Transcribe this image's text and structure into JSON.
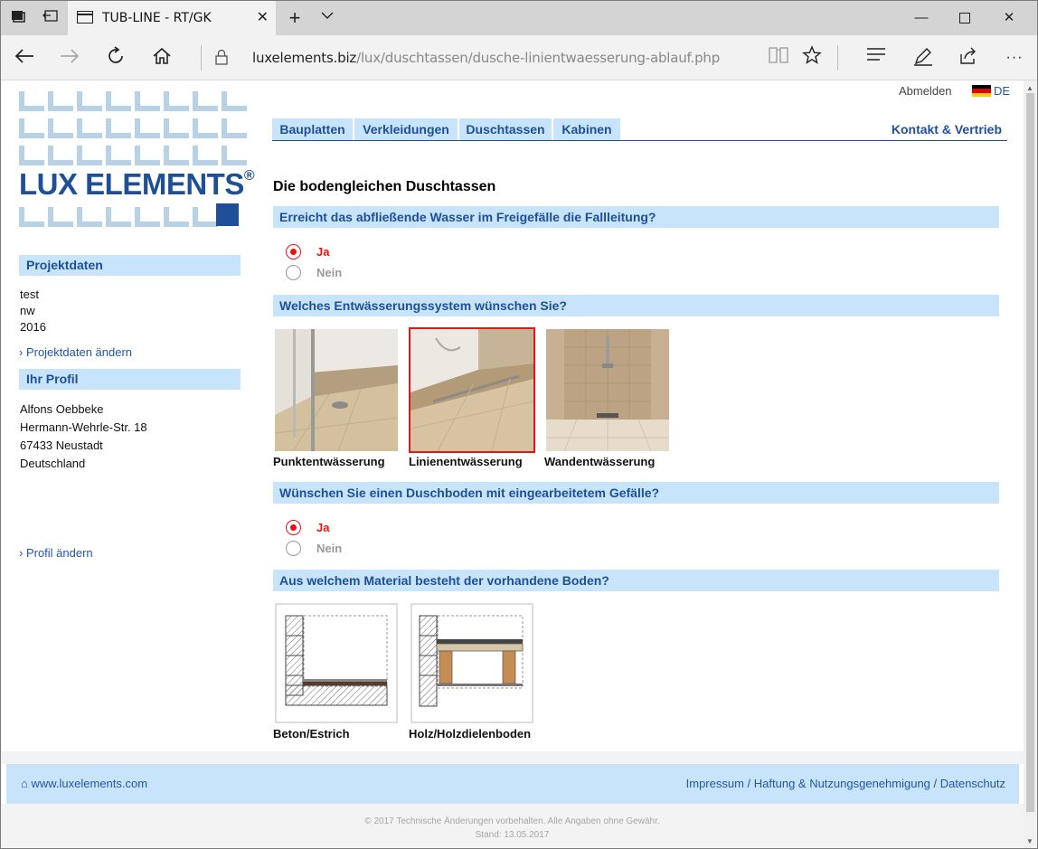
{
  "browser": {
    "tab_title": "TUB-LINE - RT/GK",
    "url_host": "luxelements.biz",
    "url_path": "/lux/duschtassen/dusche-linientwaesserung-ablauf.php"
  },
  "logo": {
    "text": "LUX ELEMENTS",
    "mark": "®"
  },
  "topbar": {
    "logout": "Abmelden",
    "language": "DE"
  },
  "nav": {
    "items": [
      "Bauplatten",
      "Verkleidungen",
      "Duschtassen",
      "Kabinen"
    ],
    "contact": "Kontakt & Vertrieb"
  },
  "sidebar": {
    "project_heading": "Projektdaten",
    "project_lines": [
      "test",
      "nw",
      "2016"
    ],
    "project_link": "› Projektdaten ändern",
    "profile_heading": "Ihr Profil",
    "profile_lines": [
      "Alfons Oebbeke",
      "Hermann-Wehrle-Str. 18",
      "67433 Neustadt",
      "Deutschland"
    ],
    "profile_link": "› Profil ändern"
  },
  "main": {
    "title": "Die bodengleichen Duschtassen",
    "questions": [
      {
        "text": "Erreicht das abfließende Wasser im Freigefälle die Fallleitung?",
        "options": [
          "Ja",
          "Nein"
        ],
        "selected": "Ja"
      },
      {
        "text": "Welches Entwässerungssystem wünschen Sie?",
        "options": [
          "Punktentwässerung",
          "Linienentwässerung",
          "Wandentwässerung"
        ],
        "selected": "Linienentwässerung"
      },
      {
        "text": "Wünschen Sie einen Duschboden mit eingearbeitetem Gefälle?",
        "options": [
          "Ja",
          "Nein"
        ],
        "selected": "Ja"
      },
      {
        "text": "Aus welchem Material besteht der vorhandene Boden?",
        "options": [
          "Beton/Estrich",
          "Holz/Holzdielenboden"
        ]
      }
    ]
  },
  "footer": {
    "site": "www.luxelements.com",
    "links": "Impressum / Haftung & Nutzungsgenehmigung / Datenschutz",
    "copyright": "© 2017 Technische Änderungen vorbehalten. Alle Angaben ohne Gewähr.",
    "stand": "Stand: 13.05.2017"
  },
  "colors": {
    "accent_blue": "#1f4f96",
    "light_blue": "#c8e4fa",
    "selected_red": "#e01818",
    "link_blue": "#2256a9"
  }
}
